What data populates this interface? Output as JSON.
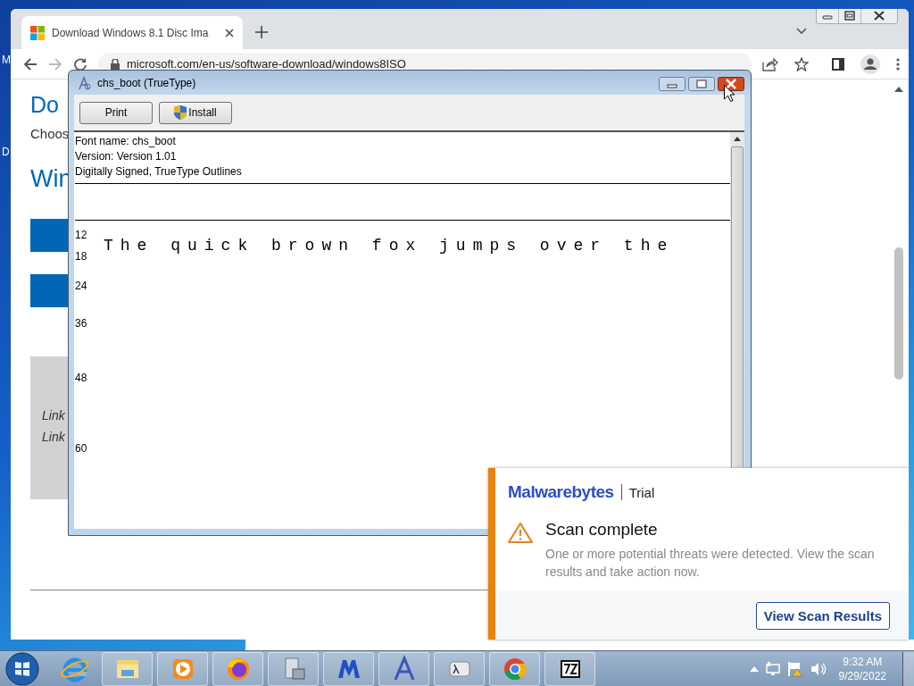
{
  "desktop": {
    "icon_labels": [
      "M",
      "D"
    ]
  },
  "browser": {
    "tabs": [
      {
        "title": "Download Windows 8.1 Disc Ima",
        "selected": true
      }
    ],
    "address": "microsoft.com/en-us/software-download/windows8ISO",
    "page": {
      "heading": "Do",
      "intro": "Choos",
      "subheading": "Win",
      "links": [
        "Link",
        "Link"
      ]
    }
  },
  "font_viewer": {
    "title": "chs_boot (TrueType)",
    "buttons": [
      "Print",
      "Install"
    ],
    "info": [
      "Font name: chs_boot",
      "Version: Version 1.01",
      "Digitally Signed, TrueType Outlines"
    ],
    "sizes": [
      {
        "size": "12"
      },
      {
        "size": "18",
        "sample": "The quick brown fox jumps over the"
      },
      {
        "size": "24"
      },
      {
        "size": "36"
      },
      {
        "size": "48"
      },
      {
        "size": "60"
      }
    ]
  },
  "notification": {
    "brand": "Malwarebytes",
    "edition": "Trial",
    "title": "Scan complete",
    "message": "One or more potential threats were detected. View the scan results and take action now.",
    "button": "View Scan Results"
  },
  "taskbar": {
    "time": "9:32 AM",
    "date": "9/29/2022"
  }
}
